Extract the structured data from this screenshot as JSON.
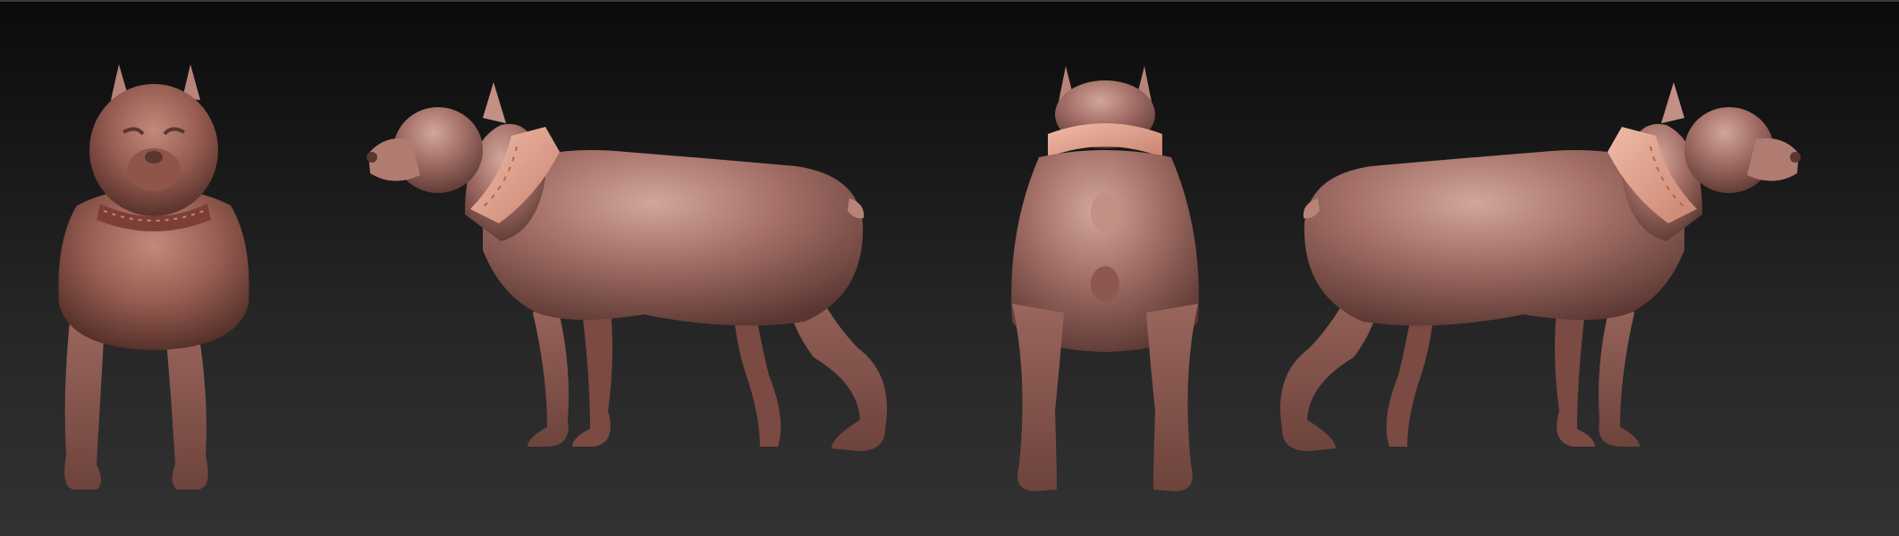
{
  "scene": {
    "subject": "dog-sculpt",
    "views": [
      {
        "view": "front"
      },
      {
        "view": "side-left"
      },
      {
        "view": "back"
      },
      {
        "view": "side-right"
      }
    ],
    "colors": {
      "background_top": "#0b0b0b",
      "background_bottom": "#323232",
      "clay_highlight": "#c99a8f",
      "clay_mid": "#9e6a61",
      "clay_shadow": "#5a3631",
      "collar": "#e3a795",
      "collar_front": "#7c3f35"
    }
  }
}
